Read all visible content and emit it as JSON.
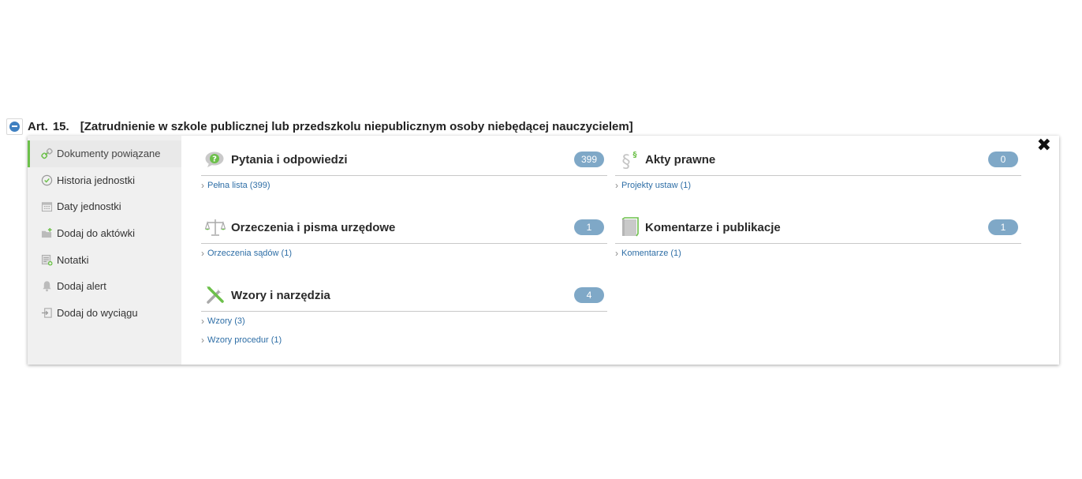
{
  "article": {
    "label": "Art.",
    "number": "15.",
    "title": "[Zatrudnienie w szkole publicznej lub przedszkolu niepublicznym osoby niebędącej nauczycielem]"
  },
  "sidebar": {
    "items": [
      {
        "label": "Dokumenty powiązane",
        "icon": "link-icon"
      },
      {
        "label": "Historia jednostki",
        "icon": "history-icon"
      },
      {
        "label": "Daty jednostki",
        "icon": "calendar-icon"
      },
      {
        "label": "Dodaj do aktówki",
        "icon": "folder-add-icon"
      },
      {
        "label": "Notatki",
        "icon": "note-icon"
      },
      {
        "label": "Dodaj alert",
        "icon": "bell-icon"
      },
      {
        "label": "Dodaj do wyciągu",
        "icon": "export-icon"
      }
    ]
  },
  "sections": {
    "qa": {
      "title": "Pytania i odpowiedzi",
      "count": "399",
      "links": [
        "Pełna lista (399)"
      ]
    },
    "acts": {
      "title": "Akty prawne",
      "count": "0",
      "links": [
        "Projekty ustaw (1)"
      ]
    },
    "rulings": {
      "title": "Orzeczenia i pisma urzędowe",
      "count": "1",
      "links": [
        "Orzeczenia sądów (1)"
      ]
    },
    "comments": {
      "title": "Komentarze i publikacje",
      "count": "1",
      "links": [
        "Komentarze (1)"
      ]
    },
    "templates": {
      "title": "Wzory i narzędzia",
      "count": "4",
      "links": [
        "Wzory (3)",
        "Wzory procedur (1)"
      ]
    }
  },
  "colors": {
    "accent": "#6cc04a",
    "badge": "#7fa8c7",
    "link": "#2e6ea6",
    "collapse": "#3f80c1"
  }
}
